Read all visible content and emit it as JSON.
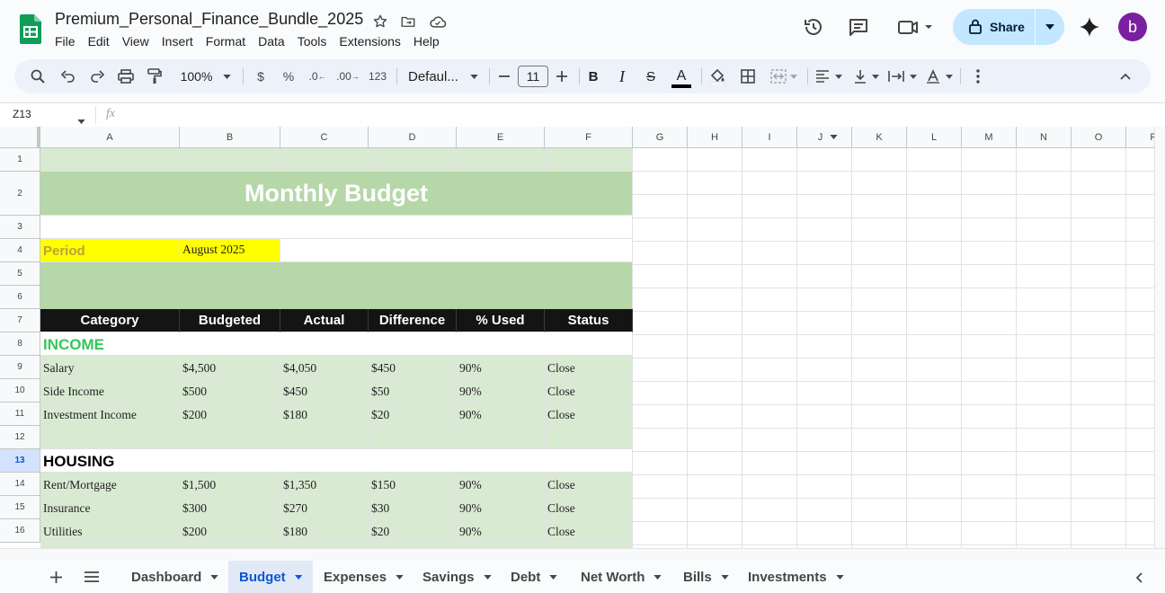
{
  "doc": {
    "title": "Premium_Personal_Finance_Bundle_2025",
    "menu": [
      "File",
      "Edit",
      "View",
      "Insert",
      "Format",
      "Data",
      "Tools",
      "Extensions",
      "Help"
    ]
  },
  "header": {
    "share_label": "Share",
    "avatar_letter": "b"
  },
  "toolbar": {
    "zoom": "100%",
    "currency": "$",
    "percent": "%",
    "dec_decrease": ".0",
    "dec_increase": ".00",
    "number_format": "123",
    "font": "Defaul...",
    "font_size": "11",
    "bold": "B",
    "italic": "I",
    "strike": "S",
    "text_color": "A"
  },
  "formula_bar": {
    "name_box": "Z13",
    "fx": "fx"
  },
  "columns": [
    "A",
    "B",
    "C",
    "D",
    "E",
    "F",
    "G",
    "H",
    "I",
    "J",
    "K",
    "L",
    "M",
    "N",
    "O",
    "P"
  ],
  "rows": [
    "1",
    "2",
    "3",
    "4",
    "5",
    "6",
    "7",
    "8",
    "9",
    "10",
    "11",
    "12",
    "13",
    "14",
    "15",
    "16"
  ],
  "sheet": {
    "title": "Monthly Budget",
    "period_label": "Period",
    "period_value": "August 2025",
    "table_headers": [
      "Category",
      "Budgeted",
      "Actual",
      "Difference",
      "% Used",
      "Status"
    ],
    "sections": {
      "income": "INCOME",
      "housing": "HOUSING"
    },
    "income_rows": [
      [
        "Salary",
        "$4,500",
        "$4,050",
        "$450",
        "90%",
        "Close"
      ],
      [
        "Side Income",
        "$500",
        "$450",
        "$50",
        "90%",
        "Close"
      ],
      [
        "Investment Income",
        "$200",
        "$180",
        "$20",
        "90%",
        "Close"
      ]
    ],
    "housing_rows": [
      [
        "Rent/Mortgage",
        "$1,500",
        "$1,350",
        "$150",
        "90%",
        "Close"
      ],
      [
        "Insurance",
        "$300",
        "$270",
        "$30",
        "90%",
        "Close"
      ],
      [
        "Utilities",
        "$200",
        "$180",
        "$20",
        "90%",
        "Close"
      ]
    ]
  },
  "tabs": [
    "Dashboard",
    "Budget",
    "Expenses",
    "Savings",
    "Debt",
    "Net Worth",
    "Bills",
    "Investments"
  ],
  "colors": {
    "title_band": "#b6d7a8",
    "row_fill": "#d9ead3",
    "period_fill": "#ffff00",
    "period_text": "#b7a43b",
    "income_text": "#34c759",
    "header_fill": "#141414"
  }
}
